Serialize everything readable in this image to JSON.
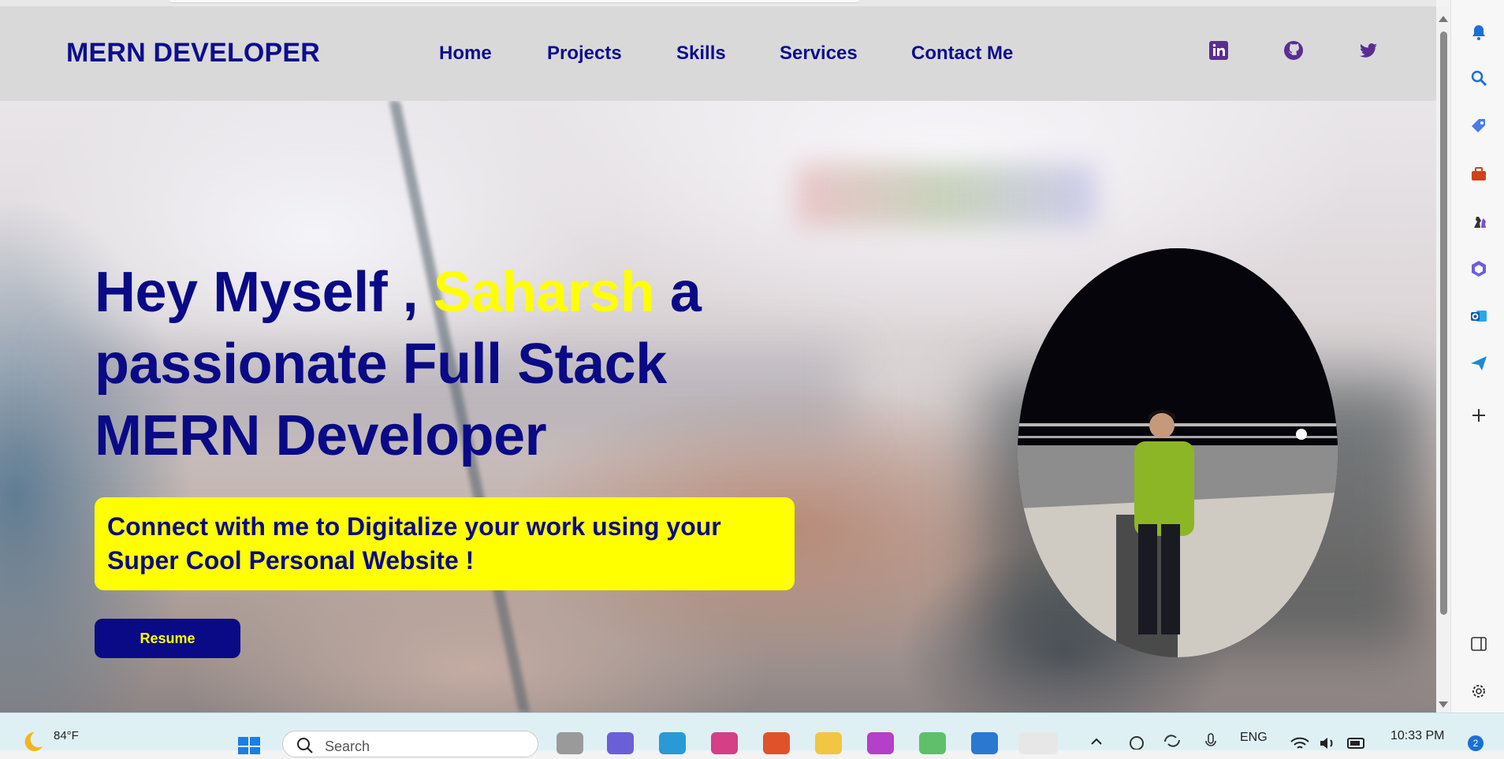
{
  "browser": {
    "scroll": {
      "position": 0.0
    }
  },
  "navbar": {
    "brand": "MERN DEVELOPER",
    "links": [
      "Home",
      "Projects",
      "Skills",
      "Services",
      "Contact Me"
    ],
    "social_icons": [
      "linkedin-icon",
      "github-icon",
      "twitter-icon"
    ]
  },
  "hero": {
    "headline_prefix": "Hey Myself , ",
    "headline_name": "Saharsh",
    "headline_rest_1": " a",
    "headline_line2": "passionate Full Stack",
    "headline_line3": "MERN Developer",
    "tagline": "Connect with me to Digitalize your work using your Super Cool Personal Website !",
    "resume_label": "Resume"
  },
  "sidepanel": {
    "icons": [
      "bell-icon",
      "search-icon",
      "tag-icon",
      "toolbox-icon",
      "chess-icon",
      "copilot-icon",
      "outlook-icon",
      "send-icon",
      "plus-icon",
      "sidebar-toggle-icon",
      "settings-icon"
    ]
  },
  "taskbar": {
    "temperature": "84°F",
    "search_placeholder": "Search",
    "language": "ENG",
    "time": "10:33 PM",
    "notification_count": "2"
  },
  "colors": {
    "brand_blue": "#0a0a86",
    "highlight_yellow": "#ffff00",
    "navbar_gray": "#d9d9d9"
  }
}
